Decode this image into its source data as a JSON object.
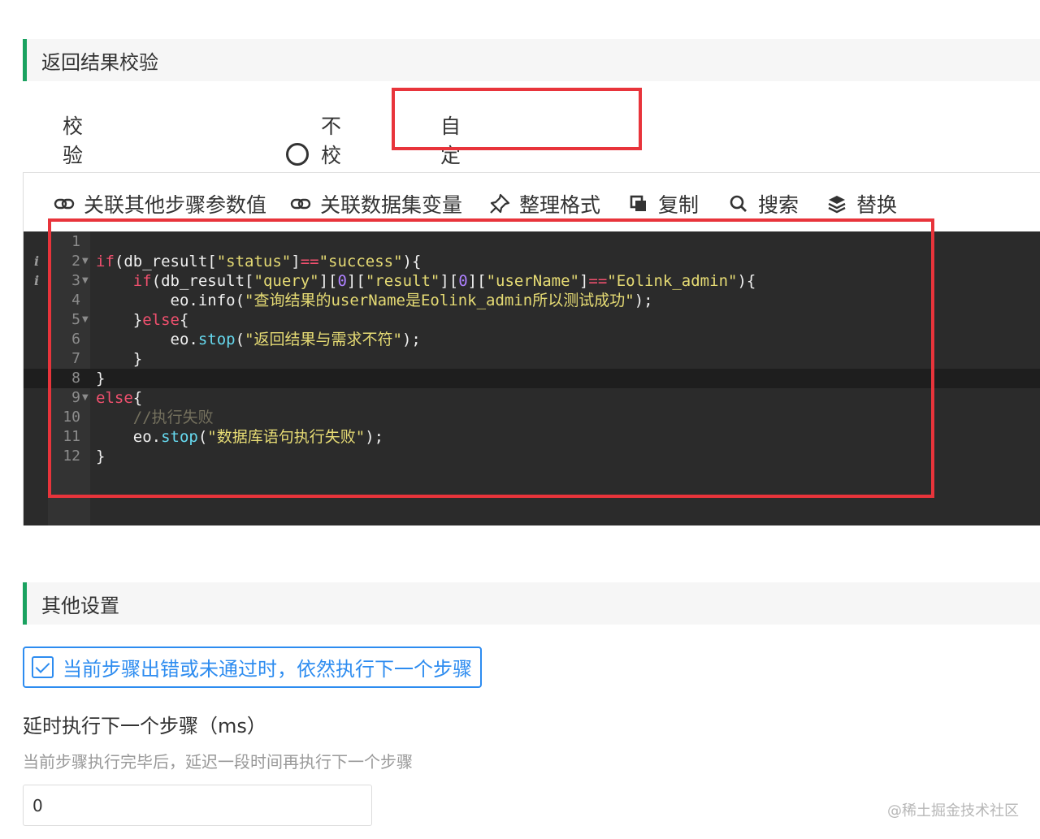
{
  "result_check": {
    "title": "返回结果校验",
    "options": [
      {
        "label": "校验全部语句执行成功",
        "selected": false
      },
      {
        "label": "不校验",
        "selected": false
      },
      {
        "label": "自定义校验规则",
        "selected": true
      }
    ]
  },
  "toolbar": {
    "link_steps": "关联其他步骤参数值",
    "link_dataset": "关联数据集变量",
    "format": "整理格式",
    "copy": "复制",
    "search": "搜索",
    "replace": "替换"
  },
  "code": {
    "line_numbers": [
      "1",
      "2",
      "3",
      "4",
      "5",
      "6",
      "7",
      "8",
      "9",
      "10",
      "11",
      "12"
    ],
    "lines": [
      "",
      "if(db_result[\"status\"]==\"success\"){",
      "    if(db_result[\"query\"][0][\"result\"][0][\"userName\"]==\"Eolink_admin\"){",
      "        eo.info(\"查询结果的userName是Eolink_admin所以测试成功\");",
      "    }else{",
      "        eo.stop(\"返回结果与需求不符\");",
      "    }",
      "}",
      "else{",
      "    //执行失败",
      "    eo.stop(\"数据库语句执行失败\");",
      "}"
    ],
    "active_line": 8,
    "annotation_marks": [
      "i",
      "i"
    ]
  },
  "other_settings": {
    "title": "其他设置",
    "continue_on_error": {
      "label": "当前步骤出错或未通过时，依然执行下一个步骤",
      "checked": true
    },
    "delay_title": "延时执行下一个步骤（ms）",
    "delay_desc": "当前步骤执行完毕后，延迟一段时间再执行下一个步骤",
    "delay_value": "0"
  },
  "watermark": "@稀土掘金技术社区",
  "colors": {
    "accent_green": "#1aa260",
    "highlight_red": "#e8343b",
    "checkbox_blue": "#2d8cf0",
    "editor_bg": "#2b2b2b"
  }
}
